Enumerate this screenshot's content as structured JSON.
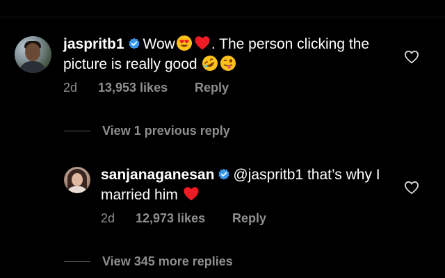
{
  "comment": {
    "username": "jaspritb1",
    "text_before": "Wow",
    "text_after": ". The person clicking the picture is really good",
    "emojis": [
      "heart-eyes-emoji",
      "red-heart-emoji",
      "rolling-laughing-emoji",
      "winking-tongue-emoji"
    ],
    "time": "2d",
    "likes": "13,953 likes",
    "reply_label": "Reply"
  },
  "view_previous": "View 1 previous reply",
  "reply": {
    "username": "sanjanaganesan",
    "mention": "@jaspritb1",
    "text": "that’s why I married him",
    "emojis": [
      "red-heart-emoji"
    ],
    "time": "2d",
    "likes": "12,973 likes",
    "reply_label": "Reply"
  },
  "view_more": "View 345 more replies",
  "colors": {
    "background": "#000000",
    "text": "#ffffff",
    "muted": "#8e8e8e",
    "verified": "#3897f0",
    "heart": "#ed1c24"
  }
}
